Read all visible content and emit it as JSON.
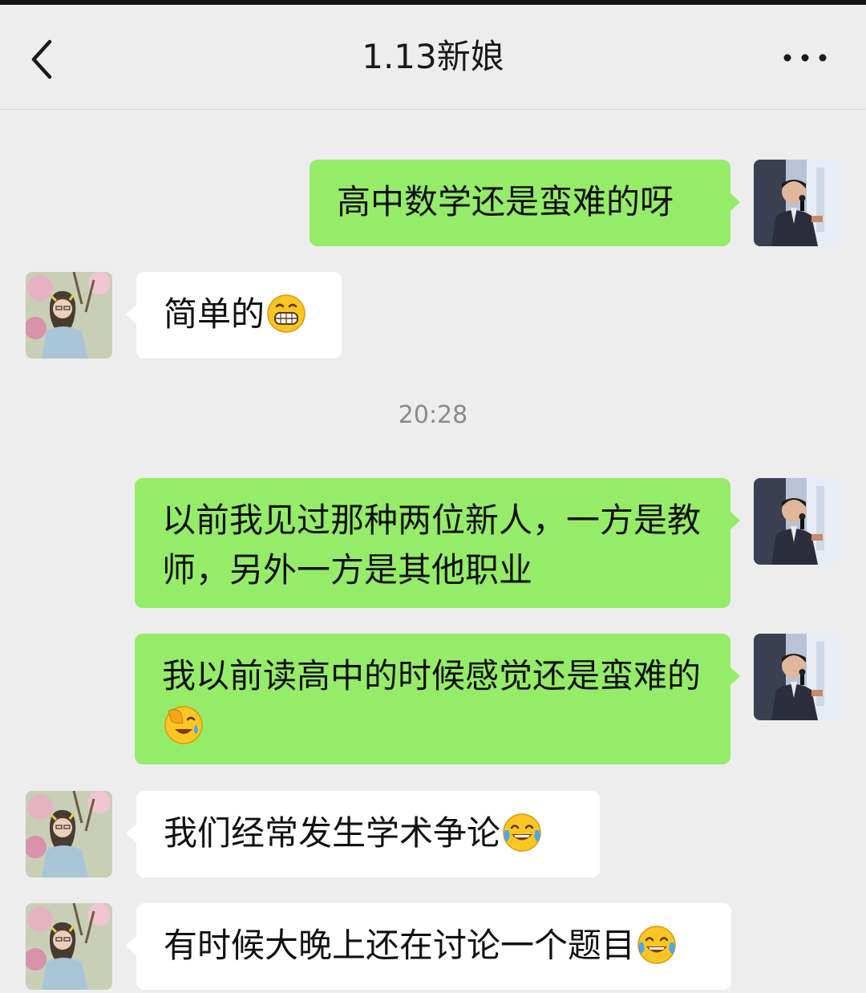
{
  "header": {
    "title": "1.13新娘",
    "back_icon": "chevron-left-icon",
    "more_icon": "more-horizontal-icon"
  },
  "timestamp": "20:28",
  "colors": {
    "background": "#ededed",
    "my_bubble": "#95ec69",
    "their_bubble": "#ffffff",
    "timestamp_text": "#8a8a8a"
  },
  "messages": [
    {
      "side": "right",
      "text": "高中数学还是蛮难的呀",
      "emoji": ""
    },
    {
      "side": "left",
      "text": "简单的",
      "emoji": "grin-emoji"
    },
    {
      "side": "right",
      "text": "以前我见过那种两位新人，一方是教师，另外一方是其他职业",
      "emoji": ""
    },
    {
      "side": "right",
      "text": "我以前读高中的时候感觉还是蛮难的",
      "emoji": "facepalm-laugh-emoji"
    },
    {
      "side": "left",
      "text": "我们经常发生学术争论",
      "emoji": "tears-of-joy-emoji"
    },
    {
      "side": "left",
      "text": "有时候大晚上还在讨论一个题目",
      "emoji": "tears-of-joy-emoji"
    }
  ]
}
